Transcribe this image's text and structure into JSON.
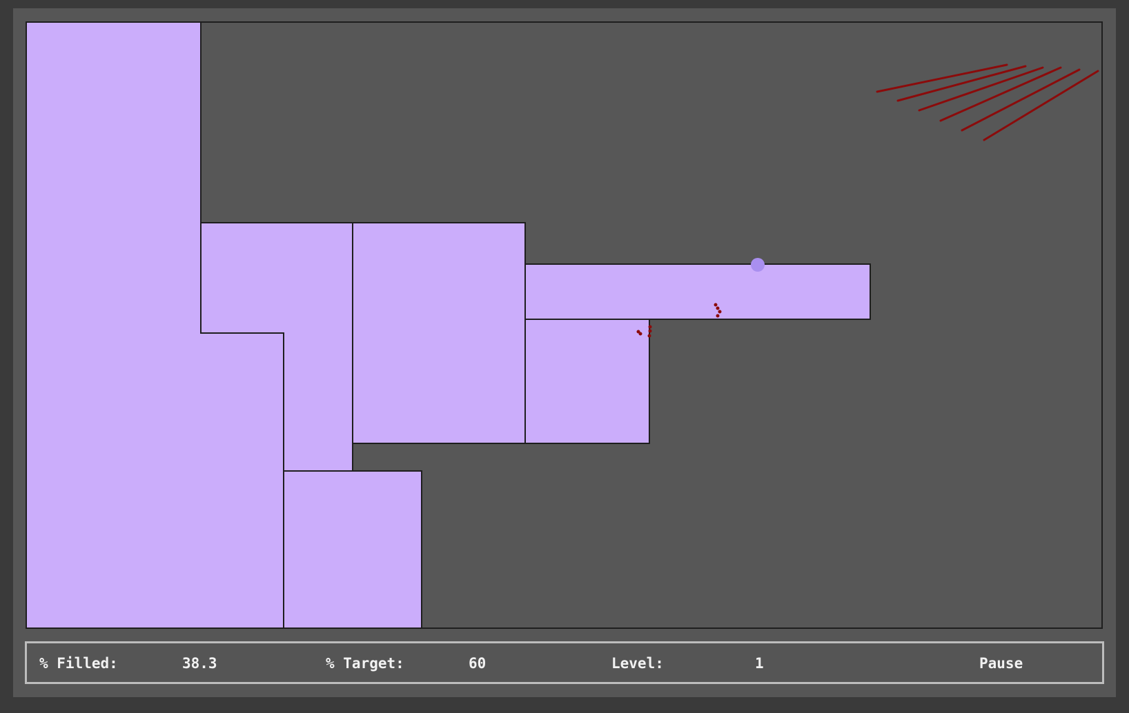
{
  "colors": {
    "background": "#3a3a3a",
    "frame": "#565656",
    "board": "#575757",
    "filled_region": "#cbadfb",
    "region_outline": "#1e1e1e",
    "ball": "#a98ff0",
    "enemy": "#8b0b0b",
    "status_text": "#f2f2f2",
    "status_border": "#bdbdbd"
  },
  "status": {
    "filled_label": "% Filled:",
    "filled_value": "38.3",
    "target_label": "% Target:",
    "target_value": "60",
    "level_label": "Level:",
    "level_value": "1",
    "pause_label": "Pause"
  }
}
